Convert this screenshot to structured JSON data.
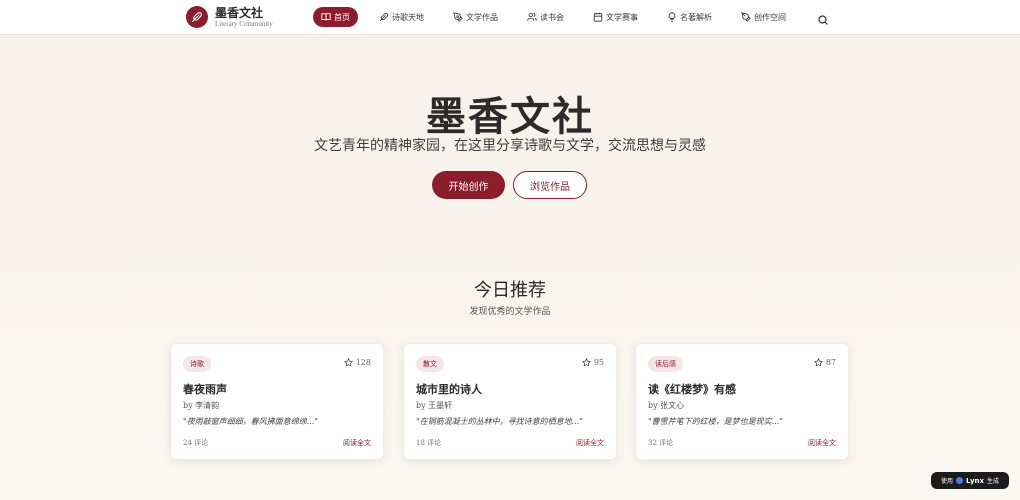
{
  "brand": {
    "title": "墨香文社",
    "subtitle": "Literary Community"
  },
  "nav": {
    "items": [
      {
        "label": "首页",
        "icon": "book-open-icon",
        "active": true
      },
      {
        "label": "诗歌天地",
        "icon": "feather-icon"
      },
      {
        "label": "文学作品",
        "icon": "pen-icon"
      },
      {
        "label": "读书会",
        "icon": "users-icon"
      },
      {
        "label": "文学赛事",
        "icon": "calendar-icon"
      },
      {
        "label": "名著解析",
        "icon": "lightbulb-icon"
      },
      {
        "label": "创作空间",
        "icon": "pen-tool-icon"
      }
    ],
    "search_icon": "search-icon"
  },
  "hero": {
    "title": "墨香文社",
    "subtitle": "文艺青年的精神家园，在这里分享诗歌与文学，交流思想与灵感",
    "primary_button": "开始创作",
    "secondary_button": "浏览作品"
  },
  "recommend": {
    "title": "今日推荐",
    "subtitle": "发现优秀的文学作品",
    "cards": [
      {
        "tag": "诗歌",
        "likes": "128",
        "title": "春夜雨声",
        "author": "by 李清韵",
        "excerpt": "\"夜雨敲窗声细细，春风拂面意绵绵...\"",
        "comments": "24 评论",
        "read": "阅读全文"
      },
      {
        "tag": "散文",
        "likes": "95",
        "title": "城市里的诗人",
        "author": "by 王墨轩",
        "excerpt": "\"在钢筋混凝土的丛林中，寻找诗意的栖息地...\"",
        "comments": "18 评论",
        "read": "阅读全文"
      },
      {
        "tag": "读后感",
        "likes": "87",
        "title": "读《红楼梦》有感",
        "author": "by 张文心",
        "excerpt": "\"曹雪芹笔下的红楼，是梦也是现实...\"",
        "comments": "32 评论",
        "read": "阅读全文"
      }
    ]
  },
  "badge": {
    "prefix": "使用",
    "name": "Lynx",
    "suffix": "生成"
  },
  "colors": {
    "accent": "#8b1d2c",
    "tag_bg": "#f6e5e8"
  }
}
